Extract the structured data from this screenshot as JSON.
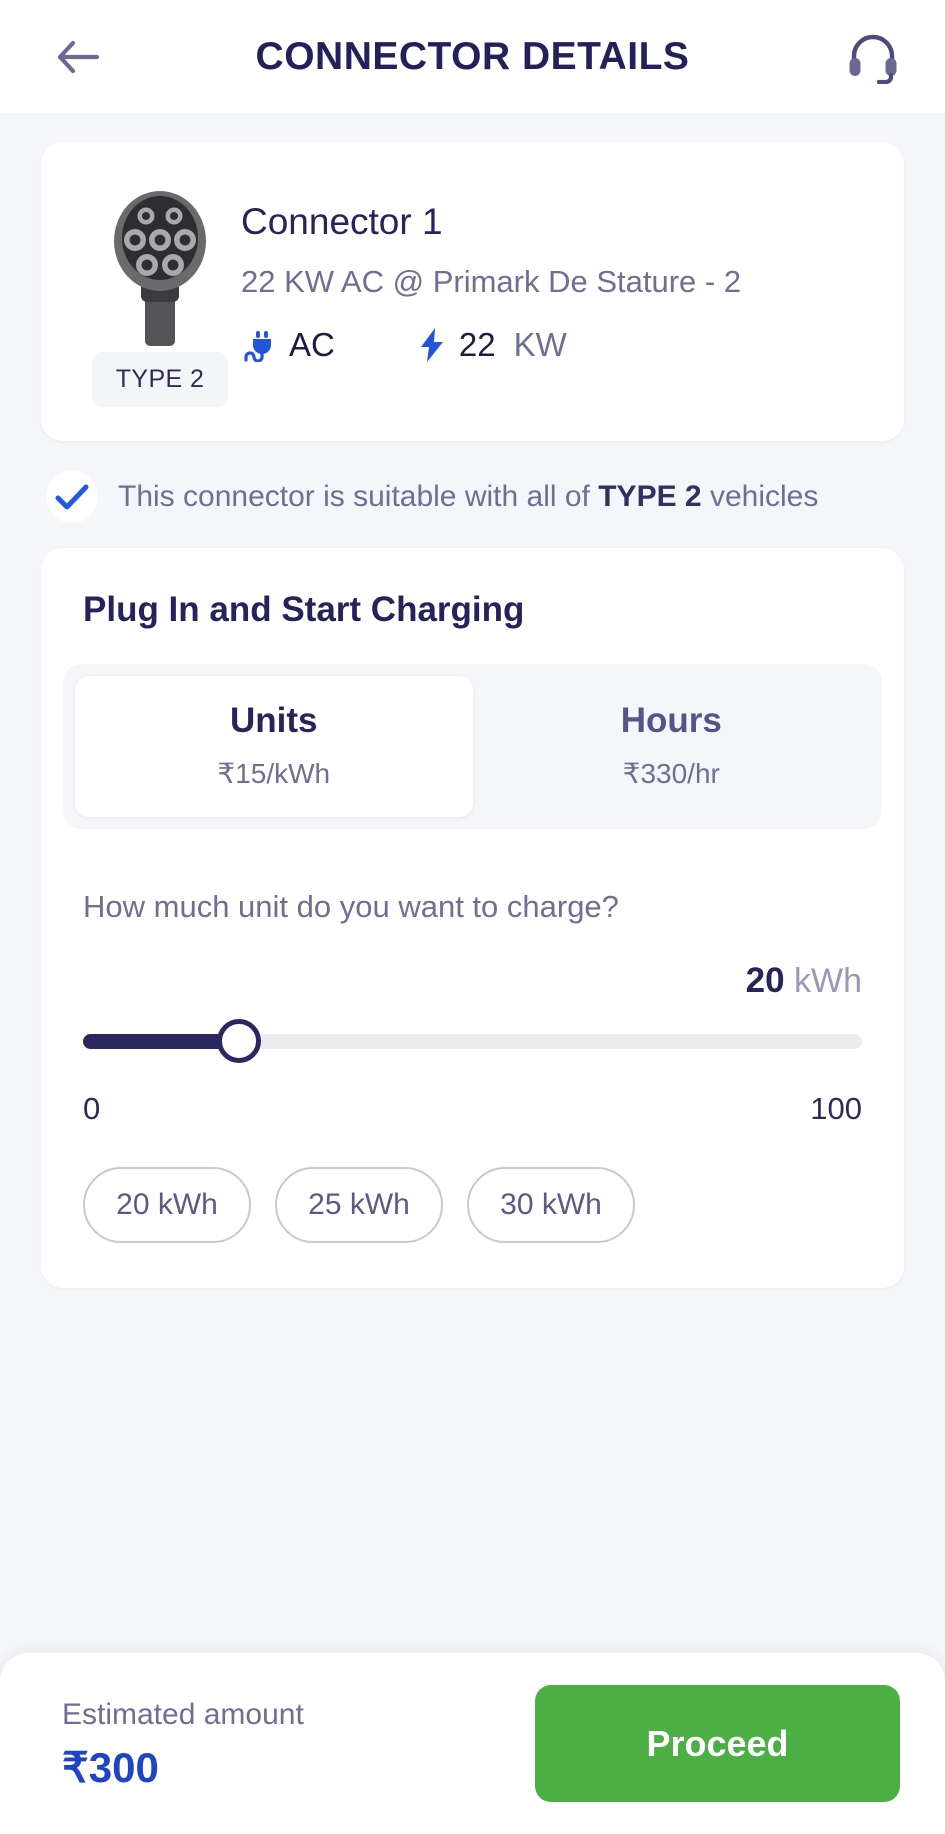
{
  "header": {
    "title": "CONNECTOR DETAILS",
    "back_icon": "arrow-left-icon",
    "support_icon": "headset-icon"
  },
  "connector": {
    "name": "Connector 1",
    "subtitle": "22 KW AC @ Primark De Stature - 2",
    "type_chip": "TYPE 2",
    "plug_icon": "ev-plug-icon",
    "current_type": "AC",
    "power_icon": "lightning-bolt-icon",
    "power_value": "22",
    "power_unit": "KW"
  },
  "suitability": {
    "check_icon": "check-icon",
    "text_before": "This connector is suitable with all of ",
    "text_bold": "TYPE 2",
    "text_after": " vehicles"
  },
  "charging": {
    "section_title": "Plug In and Start Charging",
    "modes": [
      {
        "label": "Units",
        "price": "₹15/kWh",
        "active": true
      },
      {
        "label": "Hours",
        "price": "₹330/hr",
        "active": false
      }
    ],
    "question": "How much unit do you want to charge?",
    "slider": {
      "value": "20",
      "unit": "kWh",
      "min_label": "0",
      "max_label": "100",
      "min": 0,
      "max": 100,
      "percent": 20
    },
    "quick_options": [
      "20 kWh",
      "25 kWh",
      "30 kWh"
    ]
  },
  "bottom": {
    "estimate_label": "Estimated amount",
    "estimate_amount": "₹300",
    "proceed_label": "Proceed"
  },
  "colors": {
    "navy": "#272459",
    "muted": "#6f6e93",
    "blue": "#1f45c4",
    "green": "#4caf44",
    "bg": "#f5f6f9"
  }
}
